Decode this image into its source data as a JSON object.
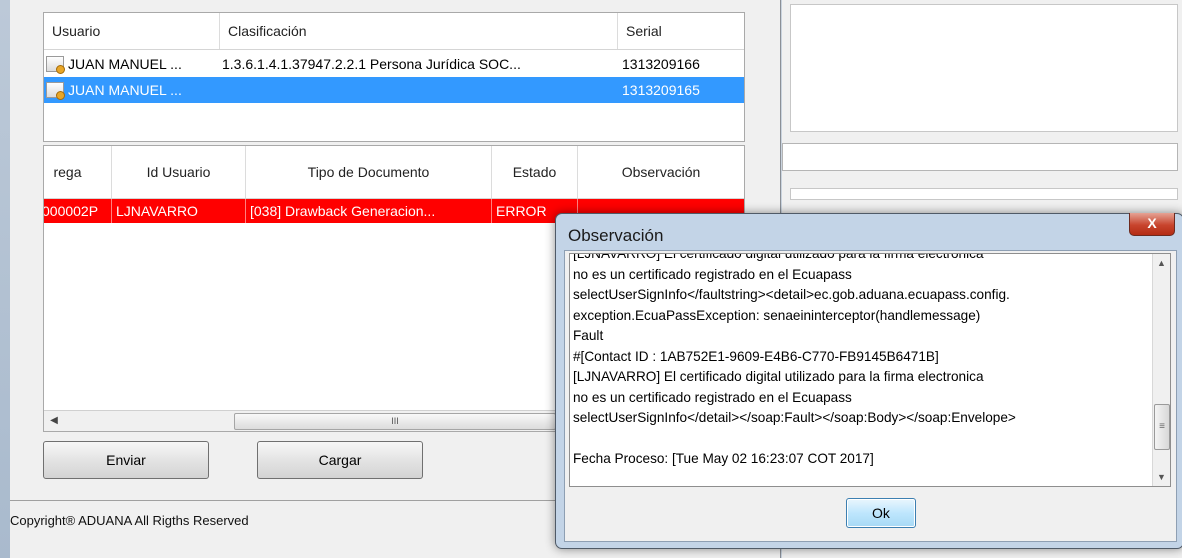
{
  "cert_table": {
    "headers": [
      "Usuario",
      "Clasificación",
      "Serial"
    ],
    "rows": [
      {
        "usuario": "JUAN MANUEL ...",
        "clasificacion": "1.3.6.1.4.1.37947.2.2.1 Persona Jurídica SOC...",
        "serial": "1313209166",
        "selected": false
      },
      {
        "usuario": "JUAN MANUEL ...",
        "clasificacion": "",
        "serial": "1313209165",
        "selected": true
      }
    ]
  },
  "doc_table": {
    "headers": [
      "rega",
      "Id Usuario",
      "Tipo de Documento",
      "Estado",
      "Observación"
    ],
    "rows": [
      {
        "entrega": "000002P",
        "id_usuario": "LJNAVARRO",
        "tipo": "[038] Drawback Generacion...",
        "estado": "ERROR",
        "observacion": ""
      }
    ],
    "hscroll_thumb": "III"
  },
  "buttons": {
    "enviar": "Enviar",
    "cargar": "Cargar"
  },
  "footer": {
    "copyright": "Copyright® ADUANA All Rigths Reserved"
  },
  "dialog": {
    "title": "Observación",
    "close_glyph": "X",
    "message_lines": [
      "[LJNAVARRO] El certificado digital utilizado para la firma electronica",
      "no es un certificado registrado en el Ecuapass",
      "selectUserSignInfo</faultstring><detail>ec.gob.aduana.ecuapass.config.",
      "exception.EcuaPassException: senaeininterceptor(handlemessage)",
      "Fault",
      "#[Contact ID : 1AB752E1-9609-E4B6-C770-FB9145B6471B]",
      "[LJNAVARRO] El certificado digital utilizado para la firma electronica",
      "no es un certificado registrado en el Ecuapass",
      "selectUserSignInfo</detail></soap:Fault></soap:Body></soap:Envelope>",
      "",
      "Fecha Proceso: [Tue May 02 16:23:07 COT 2017]"
    ],
    "ok_label": "Ok"
  },
  "colors": {
    "error_row": "#ff0000",
    "selection": "#3399ff"
  },
  "icons": [
    "certificate-icon",
    "close-icon",
    "scroll-up-icon",
    "scroll-down-icon",
    "scroll-left-icon"
  ]
}
